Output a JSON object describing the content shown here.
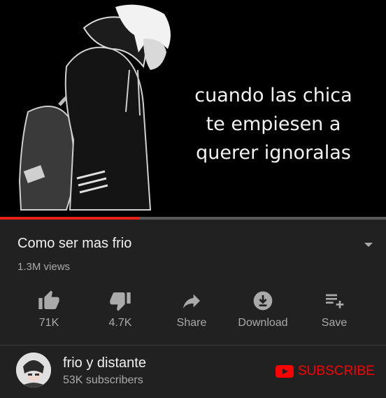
{
  "player": {
    "caption_lines": [
      "cuando las chica",
      "te empiesen a",
      "querer ignoralas"
    ],
    "progress_fraction": 0.36
  },
  "video": {
    "title": "Como ser mas frio",
    "views": "1.3M views"
  },
  "actions": [
    {
      "key": "like",
      "label": "71K",
      "icon": "thumbs-up-icon"
    },
    {
      "key": "dislike",
      "label": "4.7K",
      "icon": "thumbs-down-icon"
    },
    {
      "key": "share",
      "label": "Share",
      "icon": "share-arrow-icon"
    },
    {
      "key": "download",
      "label": "Download",
      "icon": "download-icon"
    },
    {
      "key": "save",
      "label": "Save",
      "icon": "add-to-playlist-icon"
    }
  ],
  "channel": {
    "name": "frio y distante",
    "subscribers": "53K subscribers",
    "subscribe_label": "SUBSCRIBE"
  },
  "colors": {
    "background": "#212121",
    "accent_red": "#ff0000",
    "secondary_text": "#aaaaaa"
  }
}
